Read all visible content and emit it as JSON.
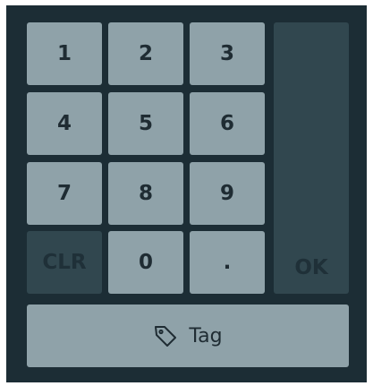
{
  "keypad": {
    "key_1": "1",
    "key_2": "2",
    "key_3": "3",
    "key_4": "4",
    "key_5": "5",
    "key_6": "6",
    "key_7": "7",
    "key_8": "8",
    "key_9": "9",
    "key_clear": "CLR",
    "key_0": "0",
    "key_decimal": ".",
    "key_ok": "OK",
    "tag_label": "Tag",
    "tag_icon": "tag-icon"
  },
  "colors": {
    "panel_background": "#1c2d35",
    "key_active": "#8fa2a9",
    "key_disabled": "#31474f",
    "key_text": "#1f2c33"
  }
}
